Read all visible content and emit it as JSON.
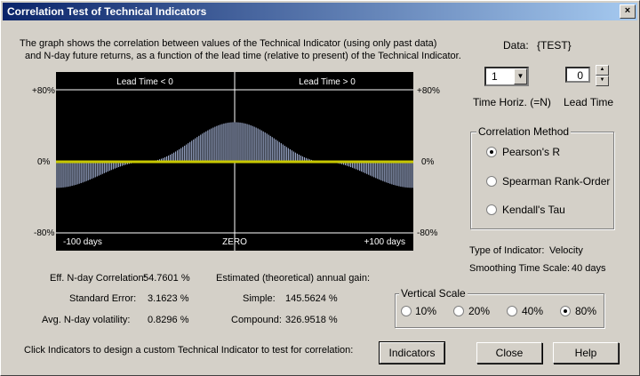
{
  "window": {
    "title": "Correlation Test of Technical Indicators",
    "close_glyph": "×"
  },
  "description": {
    "line1": "The graph shows the correlation between values of the Technical Indicator (using only past data)",
    "line2": "and N-day future returns, as a function of the lead time (relative to present) of the Technical Indicator."
  },
  "graph": {
    "left_header": "Lead Time < 0",
    "right_header": "Lead Time > 0",
    "left_footer": "-100 days",
    "center_footer": "ZERO",
    "right_footer": "+100 days",
    "y_top": "+80%",
    "y_mid": "0%",
    "y_bottom": "-80%",
    "bar_color": "#b8c8f0",
    "zero_line_color": "#c8c800"
  },
  "chart_data": {
    "type": "bar",
    "xlim": [
      -100,
      100
    ],
    "ylim": [
      -80,
      80
    ],
    "step": 1,
    "description_points": {
      "x": [
        -100,
        -50,
        0,
        50,
        100
      ],
      "y": [
        -29,
        0,
        44,
        0,
        -29
      ]
    }
  },
  "data_info": {
    "label": "Data:",
    "value": "{TEST}"
  },
  "time_horizon": {
    "value": "1",
    "label": "Time Horiz. (=N)"
  },
  "lead_time": {
    "value": "0",
    "label": "Lead Time"
  },
  "correlation_method": {
    "title": "Correlation Method",
    "options": [
      "Pearson's R",
      "Spearman Rank-Order",
      "Kendall's Tau"
    ],
    "selected": 0
  },
  "indicator_info": {
    "type_label": "Type of Indicator:",
    "type_value": "Velocity",
    "scale_label": "Smoothing Time Scale:",
    "scale_value": "40 days"
  },
  "stats": {
    "eff_label": "Eff. N-day Correlation:",
    "eff_value": "54.7601 %",
    "stderr_label": "Standard Error:",
    "stderr_value": "3.1623 %",
    "vol_label": "Avg. N-day volatility:",
    "vol_value": "0.8296 %",
    "gain_title": "Estimated (theoretical) annual gain:",
    "simple_label": "Simple:",
    "simple_value": "145.5624 %",
    "compound_label": "Compound:",
    "compound_value": "326.9518 %"
  },
  "vertical_scale": {
    "title": "Vertical Scale",
    "options": [
      "10%",
      "20%",
      "40%",
      "80%"
    ],
    "selected": 3
  },
  "footer_text": "Click Indicators to design a custom Technical Indicator to test for correlation:",
  "buttons": {
    "indicators": "Indicators",
    "close": "Close",
    "help": "Help"
  }
}
